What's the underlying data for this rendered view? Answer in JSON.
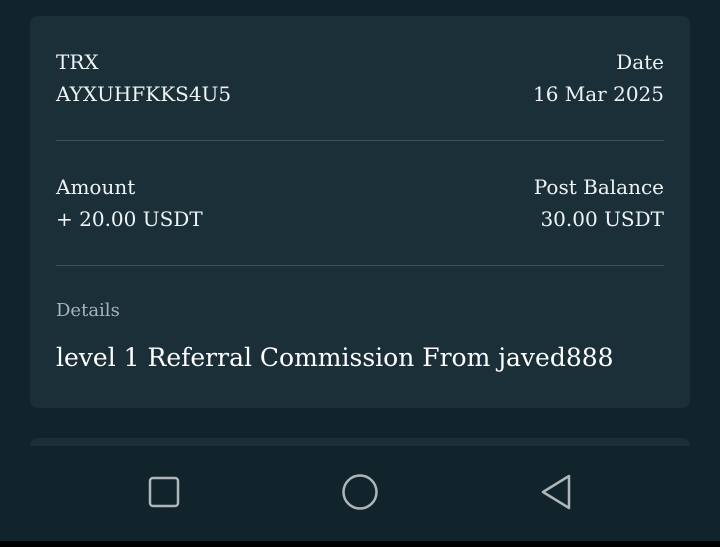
{
  "transaction": {
    "trx_label": "TRX",
    "trx_value": "AYXUHFKKS4U5",
    "date_label": "Date",
    "date_value": "16 Mar 2025",
    "amount_label": "Amount",
    "amount_value": "+ 20.00 USDT",
    "post_balance_label": "Post Balance",
    "post_balance_value": "30.00 USDT",
    "details_label": "Details",
    "details_value": "level 1 Referral Commission From javed888"
  },
  "navbar": {
    "icons": [
      "square-recents-icon",
      "circle-home-icon",
      "triangle-back-icon"
    ]
  },
  "colors": {
    "background": "#11232b",
    "card": "#1b2f38",
    "divider": "#3d5159",
    "text": "#eef3f4",
    "muted_text": "#a7b4b9"
  }
}
